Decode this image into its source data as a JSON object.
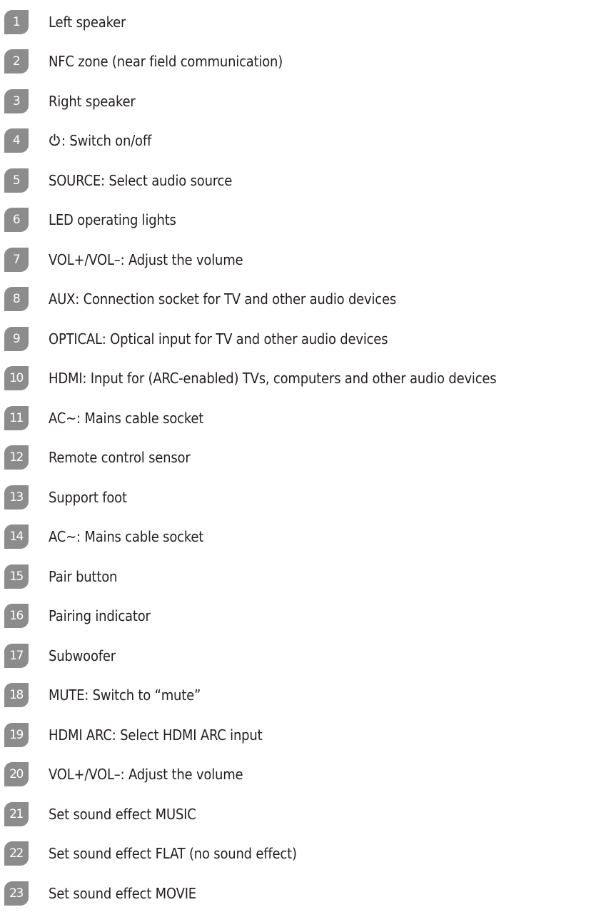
{
  "items": [
    {
      "number": "1",
      "label": "Left speaker"
    },
    {
      "number": "2",
      "label": "NFC zone (near field communication)"
    },
    {
      "number": "3",
      "label": "Right speaker"
    },
    {
      "number": "4",
      "icon": "power-icon",
      "label": ": Switch on/off"
    },
    {
      "number": "5",
      "label": "SOURCE: Select audio source"
    },
    {
      "number": "6",
      "label": "LED operating lights"
    },
    {
      "number": "7",
      "label": "VOL+/VOL–: Adjust the volume"
    },
    {
      "number": "8",
      "label": "AUX: Connection socket for TV and other audio devices"
    },
    {
      "number": "9",
      "label": "OPTICAL: Optical input for TV and other audio devices"
    },
    {
      "number": "10",
      "label": "HDMI: Input for (ARC-enabled) TVs, computers and other audio devices"
    },
    {
      "number": "11",
      "label": "AC~: Mains cable socket"
    },
    {
      "number": "12",
      "label": "Remote control sensor"
    },
    {
      "number": "13",
      "label": "Support foot"
    },
    {
      "number": "14",
      "label": "AC~: Mains cable socket"
    },
    {
      "number": "15",
      "label": "Pair button"
    },
    {
      "number": "16",
      "label": "Pairing indicator"
    },
    {
      "number": "17",
      "label": "Subwoofer"
    },
    {
      "number": "18",
      "label": "MUTE: Switch to “mute”"
    },
    {
      "number": "19",
      "label": "HDMI ARC: Select HDMI ARC input"
    },
    {
      "number": "20",
      "label": "VOL+/VOL–: Adjust the volume"
    },
    {
      "number": "21",
      "label": "Set sound effect MUSIC"
    },
    {
      "number": "22",
      "label": "Set sound effect FLAT (no sound effect)"
    },
    {
      "number": "23",
      "label": "Set sound effect MOVIE"
    }
  ],
  "colors": {
    "badge_background": "#8c8c8c",
    "badge_text": "#ffffff",
    "body_text": "#231f20"
  }
}
